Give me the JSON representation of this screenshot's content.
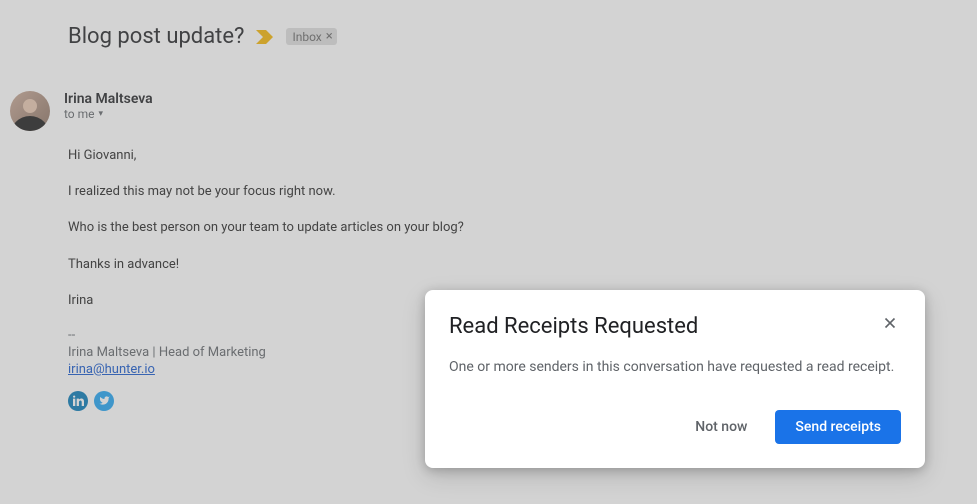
{
  "email": {
    "subject": "Blog post update?",
    "label": "Inbox",
    "sender_name": "Irina Maltseva",
    "recipient_line": "to me",
    "body": {
      "greeting": "Hi Giovanni,",
      "line1": "I realized this may not be your focus right now.",
      "line2": "Who is the best person on your team to update articles on your blog?",
      "thanks": "Thanks in advance!",
      "signoff_name": "Irina"
    },
    "signature": {
      "separator": "--",
      "title_line": "Irina Maltseva | Head of Marketing",
      "email": "irina@hunter.io"
    }
  },
  "dialog": {
    "title": "Read Receipts Requested",
    "body": "One or more senders in this conversation have requested a read receipt.",
    "not_now": "Not now",
    "send": "Send receipts"
  }
}
